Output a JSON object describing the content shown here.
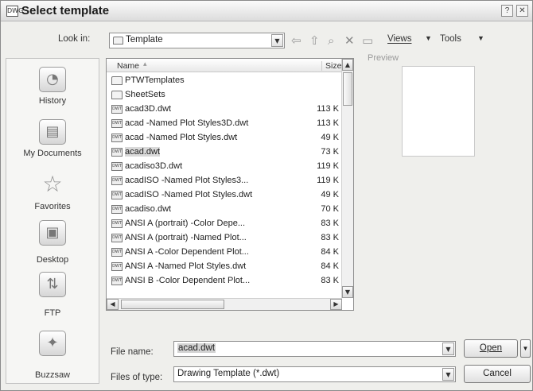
{
  "window": {
    "title": "Select template",
    "icon": "autocad-dialog-icon",
    "help_label": "?",
    "close_label": "✕"
  },
  "toolbar": {
    "look_in_label": "Look in:",
    "look_in_value": "Template",
    "views_label": "Views",
    "tools_label": "Tools",
    "icons": [
      "back-arrow-icon",
      "up-folder-icon",
      "search-web-icon",
      "delete-icon",
      "new-folder-icon"
    ]
  },
  "places": [
    {
      "label": "History",
      "icon": "history-icon"
    },
    {
      "label": "My Documents",
      "icon": "my-documents-icon"
    },
    {
      "label": "Favorites",
      "icon": "favorites-star-icon"
    },
    {
      "label": "Desktop",
      "icon": "desktop-icon"
    },
    {
      "label": "FTP",
      "icon": "ftp-icon"
    },
    {
      "label": "Buzzsaw",
      "icon": "buzzsaw-icon"
    }
  ],
  "file_list": {
    "columns": {
      "name": "Name",
      "size": "Size"
    },
    "rows": [
      {
        "name": "PTWTemplates",
        "size": "",
        "type": "folder"
      },
      {
        "name": "SheetSets",
        "size": "",
        "type": "folder"
      },
      {
        "name": "acad3D.dwt",
        "size": "113 K",
        "type": "dwt"
      },
      {
        "name": "acad -Named Plot Styles3D.dwt",
        "size": "113 K",
        "type": "dwt"
      },
      {
        "name": "acad -Named Plot Styles.dwt",
        "size": "49 K",
        "type": "dwt"
      },
      {
        "name": "acad.dwt",
        "size": "73 K",
        "type": "dwt",
        "selected": true
      },
      {
        "name": "acadiso3D.dwt",
        "size": "119 K",
        "type": "dwt"
      },
      {
        "name": "acadISO -Named Plot Styles3...",
        "size": "119 K",
        "type": "dwt"
      },
      {
        "name": "acadISO -Named Plot Styles.dwt",
        "size": "49 K",
        "type": "dwt"
      },
      {
        "name": "acadiso.dwt",
        "size": "70 K",
        "type": "dwt"
      },
      {
        "name": "ANSI A (portrait) -Color Depe...",
        "size": "83 K",
        "type": "dwt"
      },
      {
        "name": "ANSI A (portrait) -Named Plot...",
        "size": "83 K",
        "type": "dwt"
      },
      {
        "name": "ANSI A -Color Dependent Plot...",
        "size": "84 K",
        "type": "dwt"
      },
      {
        "name": "ANSI A -Named Plot Styles.dwt",
        "size": "84 K",
        "type": "dwt"
      },
      {
        "name": "ANSI B -Color Dependent Plot...",
        "size": "83 K",
        "type": "dwt"
      }
    ]
  },
  "preview": {
    "label": "Preview"
  },
  "file_name": {
    "label": "File name:",
    "value": "acad.dwt"
  },
  "file_type": {
    "label": "Files of type:",
    "value": "Drawing Template (*.dwt)"
  },
  "buttons": {
    "open": "Open",
    "cancel": "Cancel"
  }
}
